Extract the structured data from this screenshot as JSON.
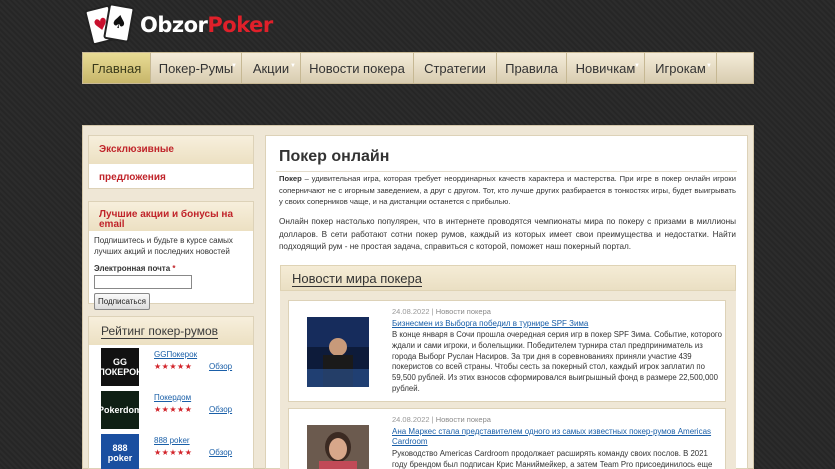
{
  "logo": {
    "text_main": "Obzor",
    "text_accent": "Poker"
  },
  "nav": [
    {
      "label": "Главная"
    },
    {
      "label": "Покер-Румы",
      "has_sub": true
    },
    {
      "label": "Акции",
      "has_sub": true
    },
    {
      "label": "Новости покера"
    },
    {
      "label": "Стратегии"
    },
    {
      "label": "Правила"
    },
    {
      "label": "Новичкам",
      "has_sub": true
    },
    {
      "label": "Игрокам",
      "has_sub": true
    }
  ],
  "sidebar": {
    "exclusive_title": "Эксклюзивные предложения",
    "promo_title": "Лучшие акции и бонусы на email",
    "promo_text": "Подпишитесь и будьте в курсе самых лучших акций и последних новостей",
    "email_label": "Электронная почта",
    "email_required": "*",
    "subscribe_label": "Подписаться",
    "rating_title": "Рейтинг покер-румов",
    "rooms": [
      {
        "name": "GGПокерок",
        "stars": "★★★★★",
        "review": "Обзор",
        "logo": "GG ПОКЕРОК",
        "color": "#111111"
      },
      {
        "name": "Покердом",
        "stars": "★★★★★",
        "review": "Обзор",
        "logo": "Pokerdom",
        "color": "#0f1f14"
      },
      {
        "name": "888 poker",
        "stars": "★★★★★",
        "review": "Обзор",
        "logo": "888 poker",
        "color": "#1a4fa0"
      }
    ]
  },
  "main": {
    "title": "Покер онлайн",
    "intro_bold": "Покер",
    "intro_rest": " – удивительная игра, которая требует неординарных качеств характера и мастерства. При игре в покер онлайн игроки соперничают не с игорным заведением, а друг с другом. Тот, кто лучше других разбирается в тонкостях игры, будет выигрывать у своих соперников чаще, и на дистанции останется с прибылью.",
    "intro2": "Онлайн покер настолько популярен, что в интернете проводятся чемпионаты мира по покеру с призами в миллионы долларов. В сети работают сотни покер румов, каждый из которых имеет свои преимущества и недостатки. Найти подходящий рум - не простая задача, справиться с которой, поможет наш покерный портал.",
    "news_title": "Новости мира покера",
    "news": [
      {
        "date": "24.08.2022",
        "separator": "|",
        "category": "Новости покера",
        "headline": "Бизнесмен из Выборга победил в турнире SPF Зима",
        "text": "В конце января в Сочи прошла очередная серия игр в покер SPF Зима. Событие, которого ждали и сами игроки, и болельщики. Победителем турнира стал предприниматель из города Выборг Руслан Насиров. За три дня в соревнованиях приняли участие 439 покеристов со всей страны. Чтобы сесть за покерный стол, каждый игрок заплатил по 59,500 рублей. Из этих взносов сформировался выигрышный фонд в размере 22,500,000 рублей."
      },
      {
        "date": "24.08.2022",
        "separator": "|",
        "category": "Новости покера",
        "headline": "Ана Маркес стала представителем одного из самых известных покер-румов Americas Cardroom",
        "text": "Руководство Americas Cardroom продолжает расширять команду своих послов. В 2021 году брендом был подписан Крис Маниймейкер, а затем Team Pro присоединилось еще"
      }
    ]
  }
}
